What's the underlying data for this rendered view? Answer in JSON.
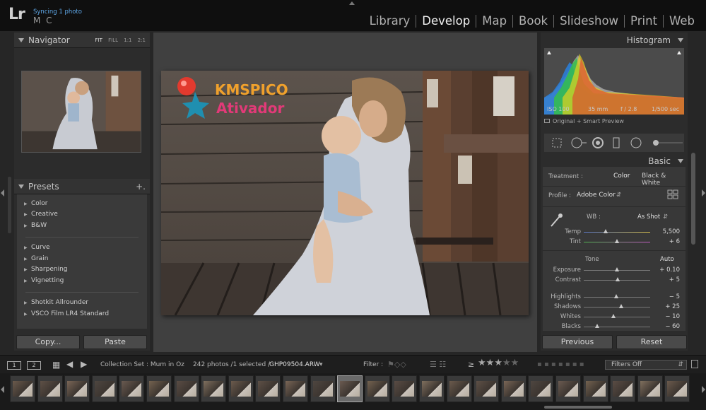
{
  "app": {
    "logo": "Lr",
    "sync_status": "Syncing 1 photo",
    "user_initials": "M C"
  },
  "modules": [
    "Library",
    "Develop",
    "Map",
    "Book",
    "Slideshow",
    "Print",
    "Web"
  ],
  "active_module": "Develop",
  "navigator": {
    "title": "Navigator",
    "zoom_options": [
      "FIT",
      "FILL",
      "1:1",
      "2:1"
    ],
    "selected_zoom": "FIT"
  },
  "presets": {
    "title": "Presets",
    "add_symbol": "+.",
    "groups": [
      [
        "Color",
        "Creative",
        "B&W"
      ],
      [
        "Curve",
        "Grain",
        "Sharpening",
        "Vignetting"
      ],
      [
        "Shotkit Allrounder",
        "VSCO Film LR4 Standard"
      ]
    ]
  },
  "left_buttons": {
    "copy": "Copy...",
    "paste": "Paste"
  },
  "watermark": {
    "line1": "KMSPICO",
    "line2": "Ativador"
  },
  "histogram": {
    "title": "Histogram",
    "iso": "ISO 100",
    "focal_length": "35 mm",
    "aperture": "f / 2.8",
    "shutter": "1/500 sec",
    "preview_status": "Original + Smart Preview"
  },
  "basic": {
    "title": "Basic",
    "treatment_label": "Treatment :",
    "treatment_color": "Color",
    "treatment_bw": "Black & White",
    "profile_label": "Profile :",
    "profile_value": "Adobe Color",
    "wb_label": "WB :",
    "wb_value": "As Shot",
    "temp_label": "Temp",
    "temp_value": "5,500",
    "tint_label": "Tint",
    "tint_value": "+ 6",
    "tone_label": "Tone",
    "auto_label": "Auto",
    "exposure_label": "Exposure",
    "exposure_value": "+ 0.10",
    "contrast_label": "Contrast",
    "contrast_value": "+ 5",
    "highlights_label": "Highlights",
    "highlights_value": "− 5",
    "shadows_label": "Shadows",
    "shadows_value": "+ 25",
    "whites_label": "Whites",
    "whites_value": "− 10",
    "blacks_label": "Blacks",
    "blacks_value": "− 60"
  },
  "slider_levels": {
    "temp": 0.33,
    "tint": 0.5,
    "exposure": 0.5,
    "contrast": 0.51,
    "highlights": 0.49,
    "shadows": 0.56,
    "whites": 0.45,
    "blacks": 0.2
  },
  "right_buttons": {
    "previous": "Previous",
    "reset": "Reset"
  },
  "toolbar": {
    "view1": "1",
    "view2": "2",
    "collection": "Collection Set : Mum in Oz",
    "count": "242 photos /1 selected /",
    "filename": "GHP09504.ARW",
    "filter_label": "Filter :",
    "rating_op": "≥",
    "rating_stars": 3,
    "filters_off": "Filters Off"
  },
  "filmstrip": {
    "thumb_count": 25,
    "selected_index": 12
  },
  "colors": {
    "accent_sync": "#5fa8e8",
    "active_module": "#f2f2f2"
  }
}
